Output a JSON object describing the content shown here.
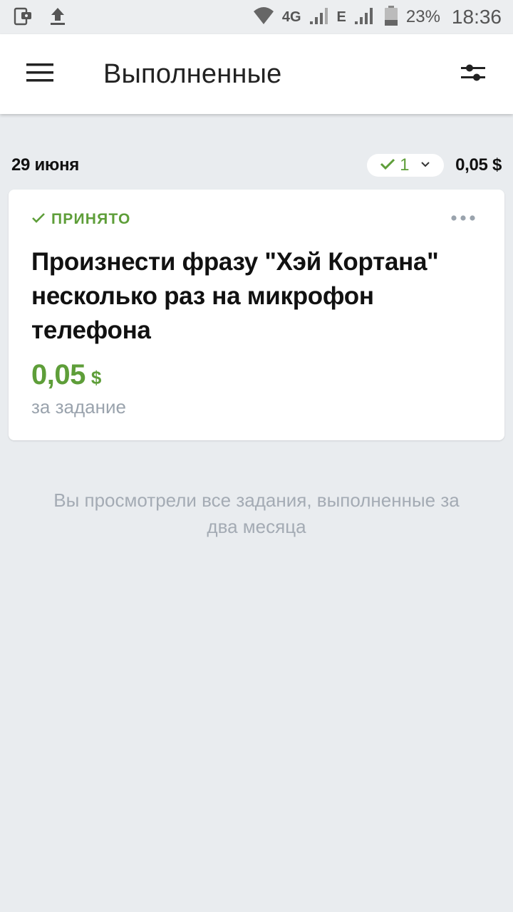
{
  "status_bar": {
    "network_label": "4G",
    "network2_label": "E",
    "battery": "23%",
    "time": "18:36"
  },
  "header": {
    "title": "Выполненные"
  },
  "group": {
    "date": "29 июня",
    "count": "1",
    "total": "0,05 $"
  },
  "task": {
    "status": "ПРИНЯТО",
    "title": "Произнести фразу \"Хэй Кортана\" несколько раз на микрофон телефона",
    "price": "0,05",
    "currency": "$",
    "price_caption": "за задание"
  },
  "footer": {
    "message": "Вы просмотрели все задания, выполненные за два месяца"
  },
  "colors": {
    "accent_green": "#5e9e39",
    "muted_text": "#a4abb4",
    "background": "#e9ecef"
  }
}
